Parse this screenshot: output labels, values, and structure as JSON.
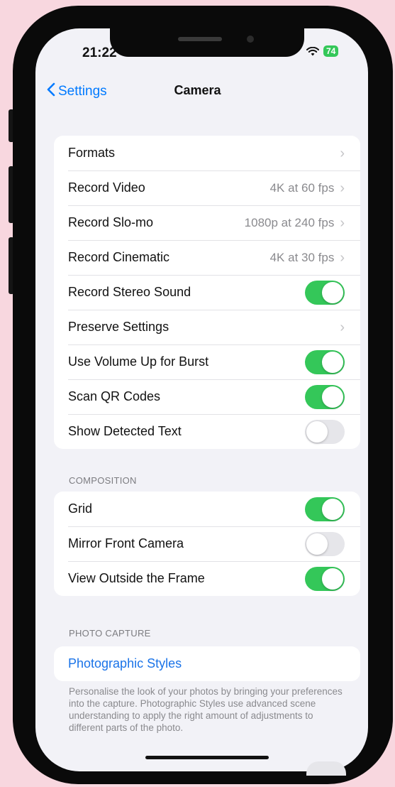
{
  "status_bar": {
    "time": "21:22",
    "battery": "74"
  },
  "nav": {
    "back_label": "Settings",
    "title": "Camera"
  },
  "main_group": [
    {
      "label": "Formats",
      "value": ""
    },
    {
      "label": "Record Video",
      "value": "4K at 60 fps"
    },
    {
      "label": "Record Slo-mo",
      "value": "1080p at 240 fps"
    },
    {
      "label": "Record Cinematic",
      "value": "4K at 30 fps"
    },
    {
      "label": "Record Stereo Sound",
      "toggle": true
    },
    {
      "label": "Preserve Settings",
      "value": ""
    },
    {
      "label": "Use Volume Up for Burst",
      "toggle": true
    },
    {
      "label": "Scan QR Codes",
      "toggle": true
    },
    {
      "label": "Show Detected Text",
      "toggle": false
    }
  ],
  "composition": {
    "header": "COMPOSITION",
    "rows": [
      {
        "label": "Grid",
        "toggle": true
      },
      {
        "label": "Mirror Front Camera",
        "toggle": false
      },
      {
        "label": "View Outside the Frame",
        "toggle": true
      }
    ]
  },
  "photo_capture": {
    "header": "PHOTO CAPTURE",
    "link_label": "Photographic Styles",
    "footer": "Personalise the look of your photos by bringing your preferences into the capture. Photographic Styles use advanced scene understanding to apply the right amount of adjustments to different parts of the photo."
  },
  "colors": {
    "accent": "#007aff",
    "toggle_on": "#34c759",
    "background": "#f2f2f7",
    "frame_bg": "#f8d7df"
  }
}
